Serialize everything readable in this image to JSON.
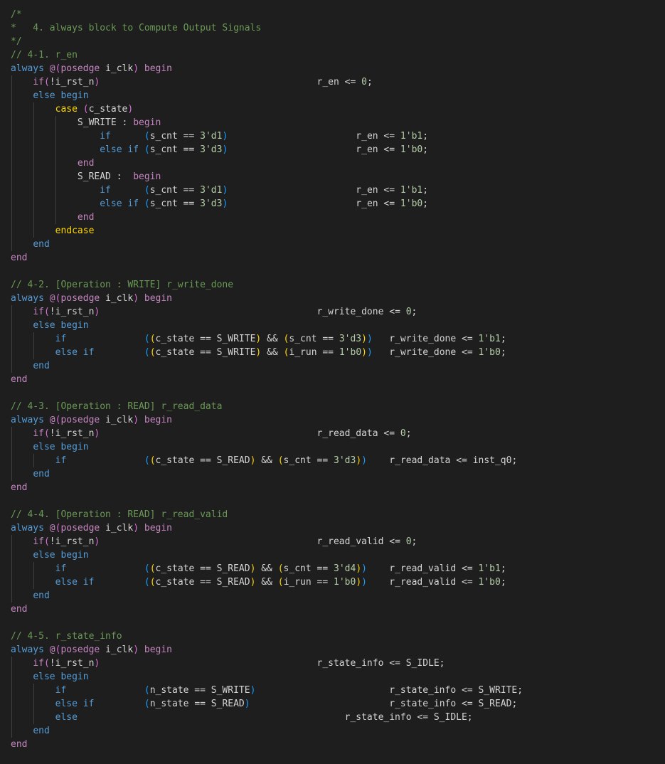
{
  "editor": {
    "colors": {
      "background": "#1e1e1e",
      "comment": "#6a9955",
      "keyword_blue": "#569cd6",
      "keyword_purple": "#c586c0",
      "keyword_orange": "#ffd700",
      "number": "#b5cea8",
      "text": "#d4d4d4",
      "bracket_level_1": "#ffd700",
      "bracket_level_2": "#da70d6",
      "bracket_level_3": "#179fff",
      "indent_guide": "#404040"
    },
    "lines": [
      [
        {
          "t": "/*",
          "k": "c"
        }
      ],
      [
        {
          "t": "*   4. always block to Compute Output Signals",
          "k": "c"
        }
      ],
      [
        {
          "t": "*/",
          "k": "c"
        }
      ],
      [
        {
          "t": "// 4-1. r_en",
          "k": "c"
        }
      ],
      [
        {
          "t": "always ",
          "k": "kb"
        },
        {
          "t": "@",
          "k": "kp"
        },
        {
          "t": "(",
          "k": "p2"
        },
        {
          "t": "posedge",
          "k": "kp"
        },
        {
          "t": " i_clk",
          "k": "v"
        },
        {
          "t": ")",
          "k": "p2"
        },
        {
          "t": " begin",
          "k": "kp"
        }
      ],
      [
        {
          "t": "    ",
          "k": "v"
        },
        {
          "t": "if",
          "k": "kp"
        },
        {
          "t": "(",
          "k": "p2"
        },
        {
          "t": "!i_rst_n",
          "k": "v"
        },
        {
          "t": ")",
          "k": "p2"
        },
        {
          "t": "                                       r_en <= ",
          "k": "v"
        },
        {
          "t": "0",
          "k": "n"
        },
        {
          "t": ";",
          "k": "v"
        }
      ],
      [
        {
          "t": "    ",
          "k": "v"
        },
        {
          "t": "else begin",
          "k": "kb"
        }
      ],
      [
        {
          "t": "        ",
          "k": "v"
        },
        {
          "t": "case",
          "k": "ko"
        },
        {
          "t": " ",
          "k": "v"
        },
        {
          "t": "(",
          "k": "p2"
        },
        {
          "t": "c_state",
          "k": "v"
        },
        {
          "t": ")",
          "k": "p2"
        }
      ],
      [
        {
          "t": "            S_WRITE : ",
          "k": "v"
        },
        {
          "t": "begin",
          "k": "kp"
        }
      ],
      [
        {
          "t": "                ",
          "k": "v"
        },
        {
          "t": "if",
          "k": "kb"
        },
        {
          "t": "      ",
          "k": "v"
        },
        {
          "t": "(",
          "k": "p3"
        },
        {
          "t": "s_cnt == ",
          "k": "v"
        },
        {
          "t": "3'd1",
          "k": "n"
        },
        {
          "t": ")",
          "k": "p3"
        },
        {
          "t": "                       r_en <= ",
          "k": "v"
        },
        {
          "t": "1'b1",
          "k": "n"
        },
        {
          "t": ";",
          "k": "v"
        }
      ],
      [
        {
          "t": "                ",
          "k": "v"
        },
        {
          "t": "else if",
          "k": "kb"
        },
        {
          "t": " ",
          "k": "v"
        },
        {
          "t": "(",
          "k": "p3"
        },
        {
          "t": "s_cnt == ",
          "k": "v"
        },
        {
          "t": "3'd3",
          "k": "n"
        },
        {
          "t": ")",
          "k": "p3"
        },
        {
          "t": "                       r_en <= ",
          "k": "v"
        },
        {
          "t": "1'b0",
          "k": "n"
        },
        {
          "t": ";",
          "k": "v"
        }
      ],
      [
        {
          "t": "            ",
          "k": "v"
        },
        {
          "t": "end",
          "k": "kp"
        }
      ],
      [
        {
          "t": "            S_READ :  ",
          "k": "v"
        },
        {
          "t": "begin",
          "k": "kp"
        }
      ],
      [
        {
          "t": "                ",
          "k": "v"
        },
        {
          "t": "if",
          "k": "kb"
        },
        {
          "t": "      ",
          "k": "v"
        },
        {
          "t": "(",
          "k": "p3"
        },
        {
          "t": "s_cnt == ",
          "k": "v"
        },
        {
          "t": "3'd1",
          "k": "n"
        },
        {
          "t": ")",
          "k": "p3"
        },
        {
          "t": "                       r_en <= ",
          "k": "v"
        },
        {
          "t": "1'b1",
          "k": "n"
        },
        {
          "t": ";",
          "k": "v"
        }
      ],
      [
        {
          "t": "                ",
          "k": "v"
        },
        {
          "t": "else if",
          "k": "kb"
        },
        {
          "t": " ",
          "k": "v"
        },
        {
          "t": "(",
          "k": "p3"
        },
        {
          "t": "s_cnt == ",
          "k": "v"
        },
        {
          "t": "3'd3",
          "k": "n"
        },
        {
          "t": ")",
          "k": "p3"
        },
        {
          "t": "                       r_en <= ",
          "k": "v"
        },
        {
          "t": "1'b0",
          "k": "n"
        },
        {
          "t": ";",
          "k": "v"
        }
      ],
      [
        {
          "t": "            ",
          "k": "v"
        },
        {
          "t": "end",
          "k": "kp"
        }
      ],
      [
        {
          "t": "        ",
          "k": "v"
        },
        {
          "t": "endcase",
          "k": "ko"
        }
      ],
      [
        {
          "t": "    ",
          "k": "v"
        },
        {
          "t": "end",
          "k": "kb"
        }
      ],
      [
        {
          "t": "end",
          "k": "kp"
        }
      ],
      [],
      [
        {
          "t": "// 4-2. [Operation : WRITE] r_write_done",
          "k": "c"
        }
      ],
      [
        {
          "t": "always ",
          "k": "kb"
        },
        {
          "t": "@",
          "k": "kp"
        },
        {
          "t": "(",
          "k": "p2"
        },
        {
          "t": "posedge",
          "k": "kp"
        },
        {
          "t": " i_clk",
          "k": "v"
        },
        {
          "t": ")",
          "k": "p2"
        },
        {
          "t": " begin",
          "k": "kp"
        }
      ],
      [
        {
          "t": "    ",
          "k": "v"
        },
        {
          "t": "if",
          "k": "kp"
        },
        {
          "t": "(",
          "k": "p2"
        },
        {
          "t": "!i_rst_n",
          "k": "v"
        },
        {
          "t": ")",
          "k": "p2"
        },
        {
          "t": "                                       r_write_done <= ",
          "k": "v"
        },
        {
          "t": "0",
          "k": "n"
        },
        {
          "t": ";",
          "k": "v"
        }
      ],
      [
        {
          "t": "    ",
          "k": "v"
        },
        {
          "t": "else begin",
          "k": "kb"
        }
      ],
      [
        {
          "t": "        ",
          "k": "v"
        },
        {
          "t": "if",
          "k": "kb"
        },
        {
          "t": "              ",
          "k": "v"
        },
        {
          "t": "(",
          "k": "p3"
        },
        {
          "t": "(",
          "k": "p1"
        },
        {
          "t": "c_state == S_WRITE",
          "k": "v"
        },
        {
          "t": ")",
          "k": "p1"
        },
        {
          "t": " && ",
          "k": "v"
        },
        {
          "t": "(",
          "k": "p1"
        },
        {
          "t": "s_cnt == ",
          "k": "v"
        },
        {
          "t": "3'd3",
          "k": "n"
        },
        {
          "t": ")",
          "k": "p1"
        },
        {
          "t": ")",
          "k": "p3"
        },
        {
          "t": "   r_write_done <= ",
          "k": "v"
        },
        {
          "t": "1'b1",
          "k": "n"
        },
        {
          "t": ";",
          "k": "v"
        }
      ],
      [
        {
          "t": "        ",
          "k": "v"
        },
        {
          "t": "else if",
          "k": "kb"
        },
        {
          "t": "         ",
          "k": "v"
        },
        {
          "t": "(",
          "k": "p3"
        },
        {
          "t": "(",
          "k": "p1"
        },
        {
          "t": "c_state == S_WRITE",
          "k": "v"
        },
        {
          "t": ")",
          "k": "p1"
        },
        {
          "t": " && ",
          "k": "v"
        },
        {
          "t": "(",
          "k": "p1"
        },
        {
          "t": "i_run == ",
          "k": "v"
        },
        {
          "t": "1'b0",
          "k": "n"
        },
        {
          "t": ")",
          "k": "p1"
        },
        {
          "t": ")",
          "k": "p3"
        },
        {
          "t": "   r_write_done <= ",
          "k": "v"
        },
        {
          "t": "1'b0",
          "k": "n"
        },
        {
          "t": ";",
          "k": "v"
        }
      ],
      [
        {
          "t": "    ",
          "k": "v"
        },
        {
          "t": "end",
          "k": "kb"
        }
      ],
      [
        {
          "t": "end",
          "k": "kp"
        }
      ],
      [],
      [
        {
          "t": "// 4-3. [Operation : READ] r_read_data",
          "k": "c"
        }
      ],
      [
        {
          "t": "always ",
          "k": "kb"
        },
        {
          "t": "@",
          "k": "kp"
        },
        {
          "t": "(",
          "k": "p2"
        },
        {
          "t": "posedge",
          "k": "kp"
        },
        {
          "t": " i_clk",
          "k": "v"
        },
        {
          "t": ")",
          "k": "p2"
        },
        {
          "t": " begin",
          "k": "kp"
        }
      ],
      [
        {
          "t": "    ",
          "k": "v"
        },
        {
          "t": "if",
          "k": "kp"
        },
        {
          "t": "(",
          "k": "p2"
        },
        {
          "t": "!i_rst_n",
          "k": "v"
        },
        {
          "t": ")",
          "k": "p2"
        },
        {
          "t": "                                       r_read_data <= ",
          "k": "v"
        },
        {
          "t": "0",
          "k": "n"
        },
        {
          "t": ";",
          "k": "v"
        }
      ],
      [
        {
          "t": "    ",
          "k": "v"
        },
        {
          "t": "else begin",
          "k": "kb"
        }
      ],
      [
        {
          "t": "        ",
          "k": "v"
        },
        {
          "t": "if",
          "k": "kb"
        },
        {
          "t": "              ",
          "k": "v"
        },
        {
          "t": "(",
          "k": "p3"
        },
        {
          "t": "(",
          "k": "p1"
        },
        {
          "t": "c_state == S_READ",
          "k": "v"
        },
        {
          "t": ")",
          "k": "p1"
        },
        {
          "t": " && ",
          "k": "v"
        },
        {
          "t": "(",
          "k": "p1"
        },
        {
          "t": "s_cnt == ",
          "k": "v"
        },
        {
          "t": "3'd3",
          "k": "n"
        },
        {
          "t": ")",
          "k": "p1"
        },
        {
          "t": ")",
          "k": "p3"
        },
        {
          "t": "    r_read_data <= inst_q0;",
          "k": "v"
        }
      ],
      [
        {
          "t": "    ",
          "k": "v"
        },
        {
          "t": "end",
          "k": "kb"
        }
      ],
      [
        {
          "t": "end",
          "k": "kp"
        }
      ],
      [],
      [
        {
          "t": "// 4-4. [Operation : READ] r_read_valid",
          "k": "c"
        }
      ],
      [
        {
          "t": "always ",
          "k": "kb"
        },
        {
          "t": "@",
          "k": "kp"
        },
        {
          "t": "(",
          "k": "p2"
        },
        {
          "t": "posedge",
          "k": "kp"
        },
        {
          "t": " i_clk",
          "k": "v"
        },
        {
          "t": ")",
          "k": "p2"
        },
        {
          "t": " begin",
          "k": "kp"
        }
      ],
      [
        {
          "t": "    ",
          "k": "v"
        },
        {
          "t": "if",
          "k": "kp"
        },
        {
          "t": "(",
          "k": "p2"
        },
        {
          "t": "!i_rst_n",
          "k": "v"
        },
        {
          "t": ")",
          "k": "p2"
        },
        {
          "t": "                                       r_read_valid <= ",
          "k": "v"
        },
        {
          "t": "0",
          "k": "n"
        },
        {
          "t": ";",
          "k": "v"
        }
      ],
      [
        {
          "t": "    ",
          "k": "v"
        },
        {
          "t": "else begin",
          "k": "kb"
        }
      ],
      [
        {
          "t": "        ",
          "k": "v"
        },
        {
          "t": "if",
          "k": "kb"
        },
        {
          "t": "              ",
          "k": "v"
        },
        {
          "t": "(",
          "k": "p3"
        },
        {
          "t": "(",
          "k": "p1"
        },
        {
          "t": "c_state == S_READ",
          "k": "v"
        },
        {
          "t": ")",
          "k": "p1"
        },
        {
          "t": " && ",
          "k": "v"
        },
        {
          "t": "(",
          "k": "p1"
        },
        {
          "t": "s_cnt == ",
          "k": "v"
        },
        {
          "t": "3'd4",
          "k": "n"
        },
        {
          "t": ")",
          "k": "p1"
        },
        {
          "t": ")",
          "k": "p3"
        },
        {
          "t": "    r_read_valid <= ",
          "k": "v"
        },
        {
          "t": "1'b1",
          "k": "n"
        },
        {
          "t": ";",
          "k": "v"
        }
      ],
      [
        {
          "t": "        ",
          "k": "v"
        },
        {
          "t": "else if",
          "k": "kb"
        },
        {
          "t": "         ",
          "k": "v"
        },
        {
          "t": "(",
          "k": "p3"
        },
        {
          "t": "(",
          "k": "p1"
        },
        {
          "t": "c_state == S_READ",
          "k": "v"
        },
        {
          "t": ")",
          "k": "p1"
        },
        {
          "t": " && ",
          "k": "v"
        },
        {
          "t": "(",
          "k": "p1"
        },
        {
          "t": "i_run == ",
          "k": "v"
        },
        {
          "t": "1'b0",
          "k": "n"
        },
        {
          "t": ")",
          "k": "p1"
        },
        {
          "t": ")",
          "k": "p3"
        },
        {
          "t": "    r_read_valid <= ",
          "k": "v"
        },
        {
          "t": "1'b0",
          "k": "n"
        },
        {
          "t": ";",
          "k": "v"
        }
      ],
      [
        {
          "t": "    ",
          "k": "v"
        },
        {
          "t": "end",
          "k": "kb"
        }
      ],
      [
        {
          "t": "end",
          "k": "kp"
        }
      ],
      [],
      [
        {
          "t": "// 4-5. r_state_info",
          "k": "c"
        }
      ],
      [
        {
          "t": "always ",
          "k": "kb"
        },
        {
          "t": "@",
          "k": "kp"
        },
        {
          "t": "(",
          "k": "p2"
        },
        {
          "t": "posedge",
          "k": "kp"
        },
        {
          "t": " i_clk",
          "k": "v"
        },
        {
          "t": ")",
          "k": "p2"
        },
        {
          "t": " begin",
          "k": "kp"
        }
      ],
      [
        {
          "t": "    ",
          "k": "v"
        },
        {
          "t": "if",
          "k": "kp"
        },
        {
          "t": "(",
          "k": "p2"
        },
        {
          "t": "!i_rst_n",
          "k": "v"
        },
        {
          "t": ")",
          "k": "p2"
        },
        {
          "t": "                                       r_state_info <= S_IDLE;",
          "k": "v"
        }
      ],
      [
        {
          "t": "    ",
          "k": "v"
        },
        {
          "t": "else begin",
          "k": "kb"
        }
      ],
      [
        {
          "t": "        ",
          "k": "v"
        },
        {
          "t": "if",
          "k": "kb"
        },
        {
          "t": "              ",
          "k": "v"
        },
        {
          "t": "(",
          "k": "p3"
        },
        {
          "t": "n_state == S_WRITE",
          "k": "v"
        },
        {
          "t": ")",
          "k": "p3"
        },
        {
          "t": "                        r_state_info <= S_WRITE;",
          "k": "v"
        }
      ],
      [
        {
          "t": "        ",
          "k": "v"
        },
        {
          "t": "else if",
          "k": "kb"
        },
        {
          "t": "         ",
          "k": "v"
        },
        {
          "t": "(",
          "k": "p3"
        },
        {
          "t": "n_state == S_READ",
          "k": "v"
        },
        {
          "t": ")",
          "k": "p3"
        },
        {
          "t": "                         r_state_info <= S_READ;",
          "k": "v"
        }
      ],
      [
        {
          "t": "        ",
          "k": "v"
        },
        {
          "t": "else",
          "k": "kb"
        },
        {
          "t": "                                                r_state_info <= S_IDLE;",
          "k": "v"
        }
      ],
      [
        {
          "t": "    ",
          "k": "v"
        },
        {
          "t": "end",
          "k": "kb"
        }
      ],
      [
        {
          "t": "end",
          "k": "kp"
        }
      ]
    ]
  }
}
